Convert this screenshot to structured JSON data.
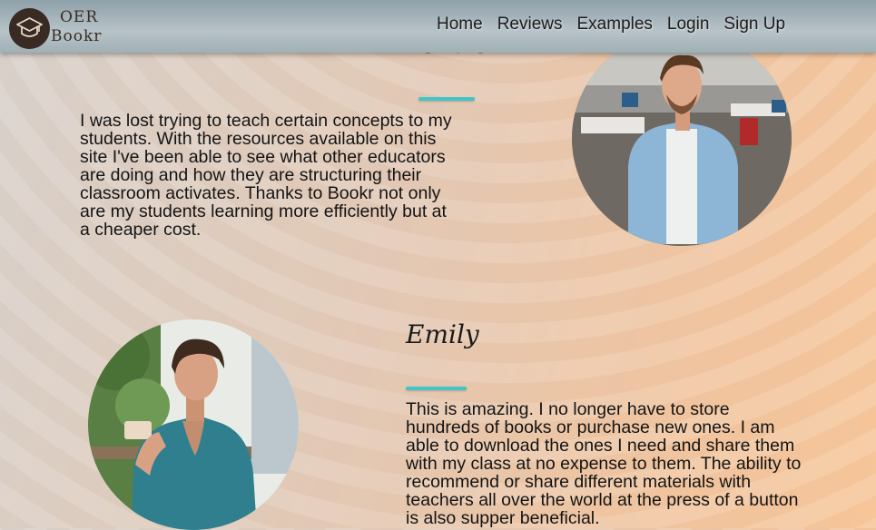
{
  "brand": {
    "line1": "OER",
    "line2": "Bookr",
    "icon": "graduation-cap-icon"
  },
  "nav": {
    "items": [
      "Home",
      "Reviews",
      "Examples",
      "Login",
      "Sign Up"
    ]
  },
  "reviews": [
    {
      "name": "Chris",
      "text": "I was lost trying to teach certain concepts to my students. With the resources available on this site I've been able to see what other educators are doing and how they are structuring their classroom activates. Thanks to Bookr not only are my students learning more efficiently but at a cheaper cost."
    },
    {
      "name": "Emily",
      "text": "This is amazing. I no longer have to store hundreds of books or purchase new ones. I am able to download the ones I need and share them with my class at no expense to them. The ability to recommend or share different materials with teachers all over the world at the press of a button is also supper beneficial."
    }
  ],
  "colors": {
    "accent_rule": "#43c4c8",
    "header": "#a8b6bc",
    "logo": "#3a2a24"
  }
}
